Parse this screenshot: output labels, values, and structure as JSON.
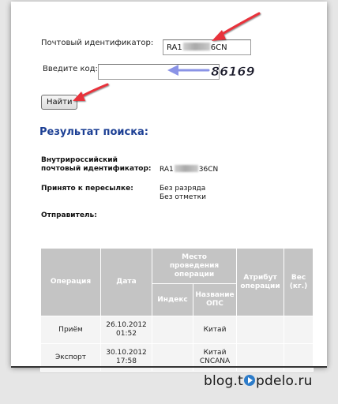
{
  "form": {
    "tracking_label": "Почтовый идентификатор:",
    "tracking_value_start": "RA1",
    "tracking_value_end": "6CN",
    "code_label": "Введите код:",
    "code_value": "",
    "find_button": "Найти"
  },
  "annotation": {
    "captcha_code": "86169"
  },
  "result": {
    "heading": "Результат поиска:",
    "internal_id_label_line1": "Внутрироссийский",
    "internal_id_label_line2": "почтовый идентификатор:",
    "internal_id_value_start": "RA1",
    "internal_id_value_end": "36CN",
    "accepted_label": "Принято к пересылке:",
    "accepted_value_line1": "Без разряда",
    "accepted_value_line2": "Без отметки",
    "sender_label": "Отправитель:"
  },
  "table": {
    "headers": {
      "operation": "Операция",
      "date": "Дата",
      "place_line1": "Место",
      "place_line2": "проведения",
      "place_line3": "операции",
      "index": "Индекс",
      "ops_name_line1": "Название",
      "ops_name_line2": "ОПС",
      "attribute_line1": "Атрибут",
      "attribute_line2": "операции",
      "weight_line1": "Вес",
      "weight_line2": "(кг.)"
    },
    "rows": [
      {
        "operation": "Приём",
        "date_line1": "26.10.2012",
        "date_line2": "01:52",
        "index": "",
        "ops_line1": "Китай",
        "ops_line2": "",
        "attribute": "",
        "weight": ""
      },
      {
        "operation": "Экспорт",
        "date_line1": "30.10.2012",
        "date_line2": "17:58",
        "index": "",
        "ops_line1": "Китай",
        "ops_line2": "CNCANA",
        "attribute": "",
        "weight": ""
      }
    ]
  },
  "watermark": {
    "prefix": "blog.t",
    "suffix": "pdelo.ru"
  },
  "colors": {
    "heading": "#1c3f94",
    "arrow_red": "#e8303a",
    "arrow_blue": "#8a93e6",
    "table_header": "#c4c4c4",
    "table_cell": "#f4f4f4"
  }
}
